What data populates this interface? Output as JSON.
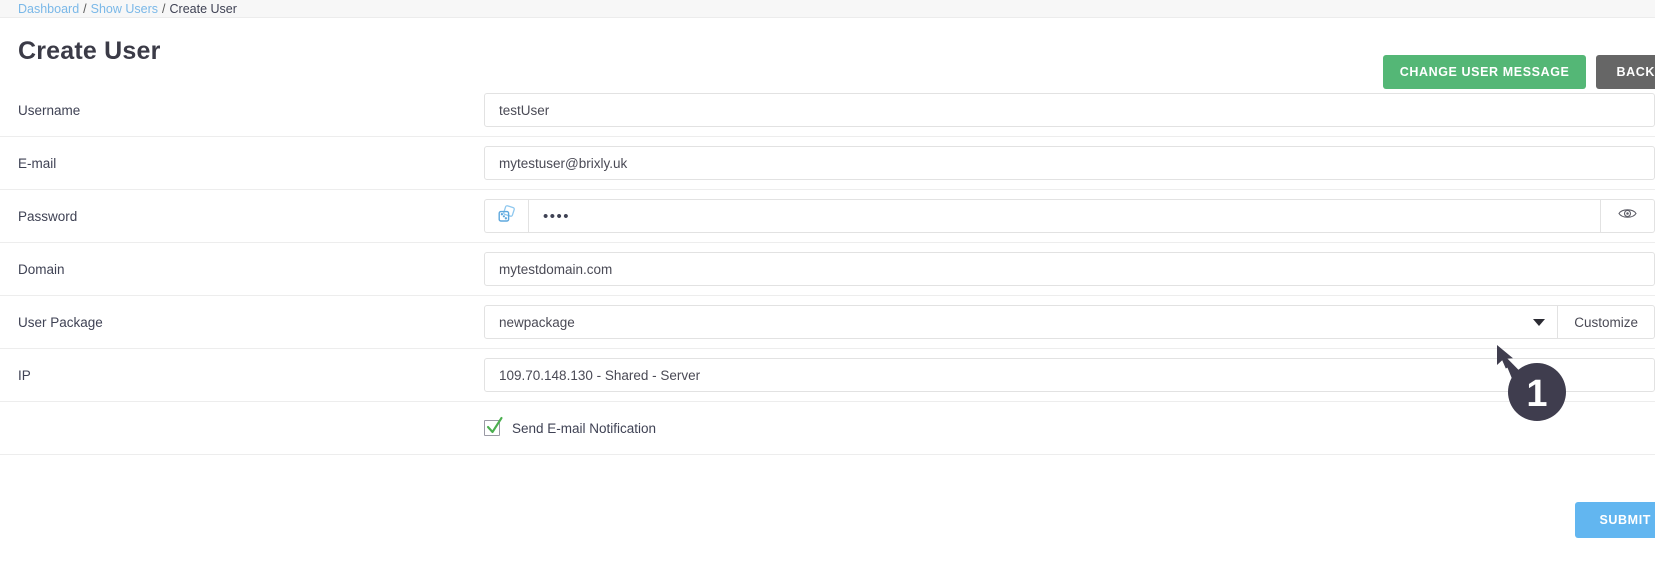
{
  "breadcrumb": {
    "items": [
      {
        "label": "Dashboard",
        "link": true
      },
      {
        "label": "Show Users",
        "link": true
      },
      {
        "label": "Create User",
        "link": false
      }
    ],
    "separator": "/"
  },
  "header": {
    "title": "Create User",
    "change_user_message_label": "CHANGE USER MESSAGE",
    "back_label": "BACK"
  },
  "form": {
    "username": {
      "label": "Username",
      "value": "testUser"
    },
    "email": {
      "label": "E-mail",
      "value": "mytestuser@brixly.uk"
    },
    "password": {
      "label": "Password",
      "value": "••••",
      "generate_icon": "dice-icon",
      "reveal_icon": "eye-icon"
    },
    "domain": {
      "label": "Domain",
      "value": "mytestdomain.com"
    },
    "user_package": {
      "label": "User Package",
      "value": "newpackage",
      "customize_label": "Customize",
      "caret_icon": "chevron-down-icon"
    },
    "ip": {
      "label": "IP",
      "value": "109.70.148.130 - Shared - Server"
    },
    "send_email_notification": {
      "label": "Send E-mail Notification",
      "checked": true
    }
  },
  "footer": {
    "submit_label": "SUBMIT"
  },
  "annotation": {
    "step_number": "1"
  },
  "colors": {
    "green_button": "#54b776",
    "gray_button": "#666666",
    "blue_button": "#62b6f0",
    "link": "#7ab8e8",
    "badge": "#3f3d4e",
    "check": "#4caf50"
  }
}
